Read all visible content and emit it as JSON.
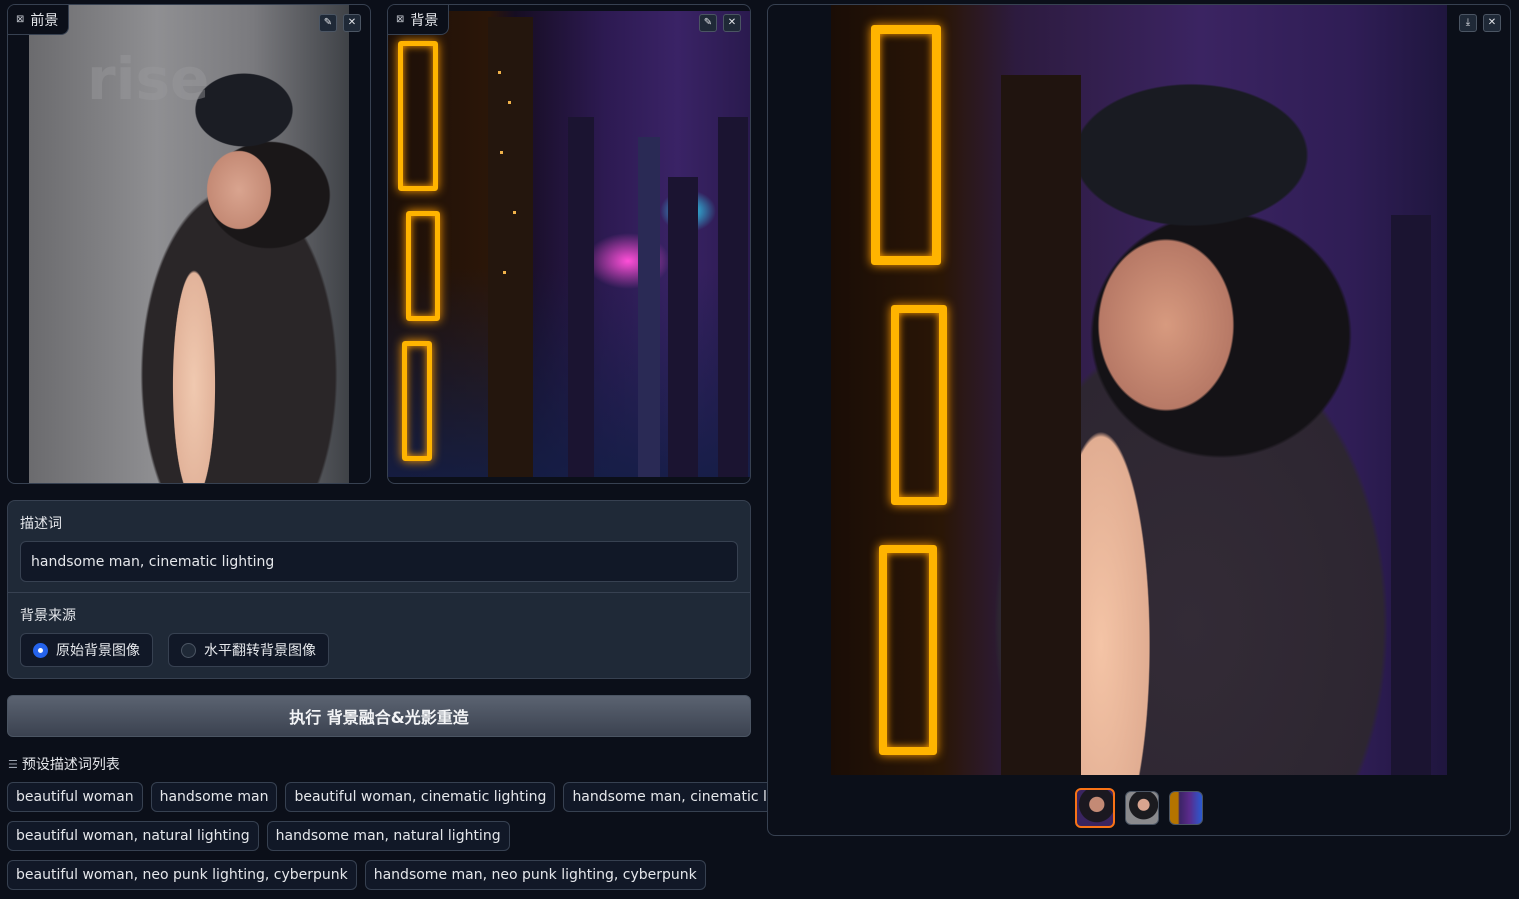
{
  "foreground": {
    "label": "前景",
    "label_icon": "image-icon",
    "wall_text": "rise",
    "edit_icon": "✎",
    "close_icon": "✕"
  },
  "background": {
    "label": "背景",
    "label_icon": "image-icon",
    "edit_icon": "✎",
    "close_icon": "✕"
  },
  "form": {
    "prompt_label": "描述词",
    "prompt_value": "handsome man, cinematic lighting",
    "source_label": "背景来源",
    "radio_options": [
      "原始背景图像",
      "水平翻转背景图像"
    ],
    "selected_option": "原始背景图像"
  },
  "run_button": "执行 背景融合&光影重造",
  "presets": {
    "title": "预设描述词列表",
    "title_icon": "☰",
    "items": [
      "beautiful woman",
      "handsome man",
      "beautiful woman, cinematic lighting",
      "handsome man, cinematic lighting",
      "beautiful woman, natural lighting",
      "handsome man, natural lighting",
      "beautiful woman, neo punk lighting, cyberpunk",
      "handsome man, neo punk lighting, cyberpunk"
    ]
  },
  "output": {
    "download_icon": "⤓",
    "close_icon": "✕",
    "thumbnail_count": 3,
    "selected_thumbnail": 1
  },
  "colors": {
    "accent": "#2563eb",
    "thumb_active": "#f97316",
    "neon": "#ffb400"
  }
}
